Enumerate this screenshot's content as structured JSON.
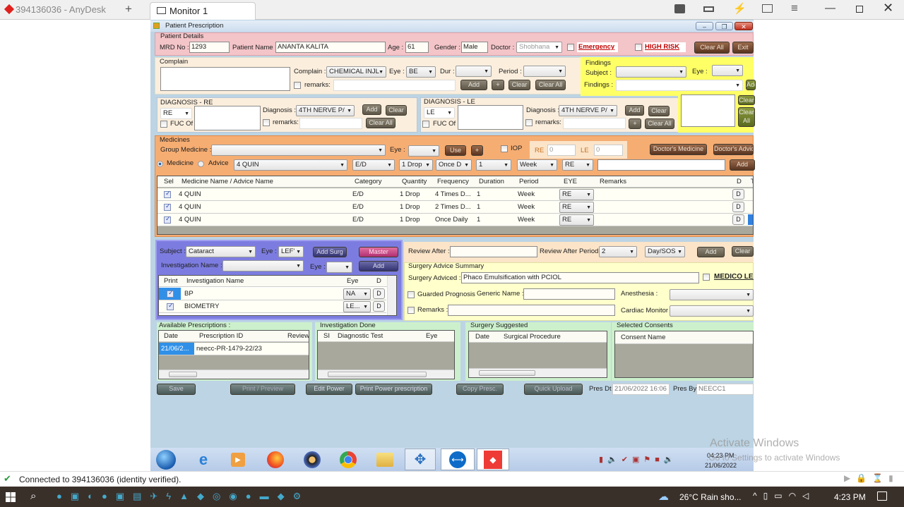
{
  "anydesk": {
    "tab_title": "394136036 - AnyDesk",
    "new_tab": "+",
    "monitor_tab": "Monitor 1",
    "status": "Connected to 394136036 (identity verified)."
  },
  "window": {
    "title": "Patient Prescription"
  },
  "patient": {
    "legend": "Patient Details",
    "mrd_label": "MRD No :",
    "mrd": "1293",
    "name_label": "Patient Name :",
    "name": "ANANTA  KALITA",
    "age_label": "Age :",
    "age": "61",
    "gender_label": "Gender :",
    "gender": "Male",
    "doctor_label": "Doctor :",
    "doctor": "Shobhana",
    "emergency": "Emergency",
    "high_risk": "HIGH RISK",
    "clear_all": "Clear All",
    "exit": "Exit"
  },
  "complain": {
    "legend": "Complain",
    "complain_label": "Complain :",
    "complain": "CHEMICAL INJL",
    "eye_label": "Eye :",
    "eye": "BE",
    "dur_label": "Dur :",
    "period_label": "Period :",
    "remarks_label": "remarks:",
    "add": "Add",
    "plus": "+",
    "clear": "Clear",
    "clear_all": "Clear All"
  },
  "findings": {
    "legend": "Findings",
    "subject_label": "Subject :",
    "eye_label": "Eye :",
    "findings_label": "Findings :",
    "add": "Add",
    "clear": "Clear",
    "clear_all": "Clear All"
  },
  "diag_re": {
    "legend": "DIAGNOSIS - RE",
    "eye": "RE",
    "fuc": "FUC Of",
    "diagnosis_label": "Diagnosis :",
    "diagnosis": "4TH  NERVE P/",
    "remarks_label": "remarks:",
    "add": "Add",
    "clear": "Clear",
    "clear_all": "Clear All"
  },
  "diag_le": {
    "legend": "DIAGNOSIS - LE",
    "eye": "LE",
    "fuc": "FUC Of",
    "diagnosis_label": "Diagnosis :",
    "diagnosis": "4TH  NERVE P/",
    "remarks_label": "remarks:",
    "add": "Add",
    "plus": "+",
    "clear": "Clear",
    "clear_all": "Clear All"
  },
  "medicines": {
    "legend": "Medicines",
    "group_label": "Group Medicine :",
    "eye_label": "Eye :",
    "use": "Use",
    "plus": "+",
    "iop": "IOP",
    "re_label": "RE",
    "re_val": "0",
    "le_label": "LE",
    "le_val": "0",
    "doctors_medicine": "Doctor's Medicine",
    "doctors_advice": "Doctor's Advice",
    "radio_medicine": "Medicine",
    "radio_advice": "Advice",
    "medicine": "4 QUIN",
    "category": "E/D",
    "quantity": "1 Drop",
    "frequency": "Once D",
    "duration": "1",
    "period": "Week",
    "eye": "RE",
    "add": "Add",
    "columns": [
      "Sel",
      "Medicine Name / Advice Name",
      "Category",
      "Quantity",
      "Frequency",
      "Duration",
      "Period",
      "EYE",
      "Remarks",
      "D",
      "T"
    ],
    "rows": [
      {
        "name": "4 QUIN",
        "category": "E/D",
        "quantity": "1 Drop",
        "frequency": "4 Times D...",
        "duration": "1",
        "period": "Week",
        "eye": "RE",
        "d": "D"
      },
      {
        "name": "4 QUIN",
        "category": "E/D",
        "quantity": "1 Drop",
        "frequency": "2 Times D...",
        "duration": "1",
        "period": "Week",
        "eye": "RE",
        "d": "D"
      },
      {
        "name": "4 QUIN",
        "category": "E/D",
        "quantity": "1 Drop",
        "frequency": "Once  Daily",
        "duration": "1",
        "period": "Week",
        "eye": "RE",
        "d": "D"
      }
    ]
  },
  "surgery": {
    "subject_label": "Subject :",
    "subject": "Cataract",
    "eye_label": "Eye :",
    "eye": "LEF'",
    "add_surg": "Add Surg",
    "master": "Master",
    "inv_label": "Investigation Name :",
    "inv_eye_label": "Eye :",
    "add": "Add",
    "columns": [
      "Print",
      "Investigation Name",
      "Eye",
      "D"
    ],
    "rows": [
      {
        "name": "BP",
        "eye": "NA",
        "d": "D"
      },
      {
        "name": "BIOMETRY",
        "eye": "LE...",
        "d": "D"
      }
    ]
  },
  "review": {
    "after_label": "Review After :",
    "period_label": "Review After Period :",
    "period": "2",
    "unit": "Day/SOS",
    "add": "Add",
    "clear": "Clear"
  },
  "advice": {
    "legend": "Surgery Advice Summary",
    "adviced_label": "Surgery Adviced :",
    "adviced": "Phaco Emulsification with PCIOL",
    "medico": "MEDICO LEGAL",
    "guarded": "Guarded Prognosis",
    "generic_label": "Generic Name :",
    "anesthesia_label": "Anesthesia :",
    "remarks_label": "Remarks :",
    "cardiac_label": "Cardiac Monitor :"
  },
  "available": {
    "legend": "Available Prescriptions :",
    "columns": [
      "Date",
      "Prescription ID",
      "Review"
    ],
    "rows": [
      {
        "date": "21/06/2...",
        "id": "neecc-PR-1479-22/23"
      }
    ]
  },
  "inv_done": {
    "legend": "Investigation Done",
    "columns": [
      "SI",
      "Diagnostic Test",
      "Eye"
    ]
  },
  "surg_suggested": {
    "legend": "Surgery Suggested",
    "columns": [
      "Date",
      "Surgical Procedure"
    ]
  },
  "consents": {
    "legend": "Selected Consents",
    "columns": [
      "Consent Name"
    ]
  },
  "footer": {
    "save": "Save",
    "print_preview": "Print / Preview",
    "edit_power": "Edit Power",
    "print_power": "Print Power prescription",
    "copy": "Copy Presc.",
    "quick_upload": "Quick Upload",
    "pres_dt_label": "Pres Dt",
    "pres_dt": "21/06/2022 16:06",
    "pres_by_label": "Pres By",
    "pres_by": "NEECC1"
  },
  "watermark": {
    "title": "Activate Windows",
    "sub": "Go to Settings to activate Windows."
  },
  "remote_taskbar": {
    "time": "04:23 PM",
    "date": "21/06/2022"
  },
  "taskbar": {
    "weather": "26°C  Rain sho...",
    "time": "4:23 PM"
  },
  "colors": {
    "patient": "#f3c4c8",
    "complain": "#fbeedd",
    "findings": "#ffff66",
    "medicines": "#f6ad72",
    "surgery": "#7c7ce0",
    "advice": "#ffffcc",
    "bottom": "#ccf0cc",
    "emergency": "#c00000"
  }
}
